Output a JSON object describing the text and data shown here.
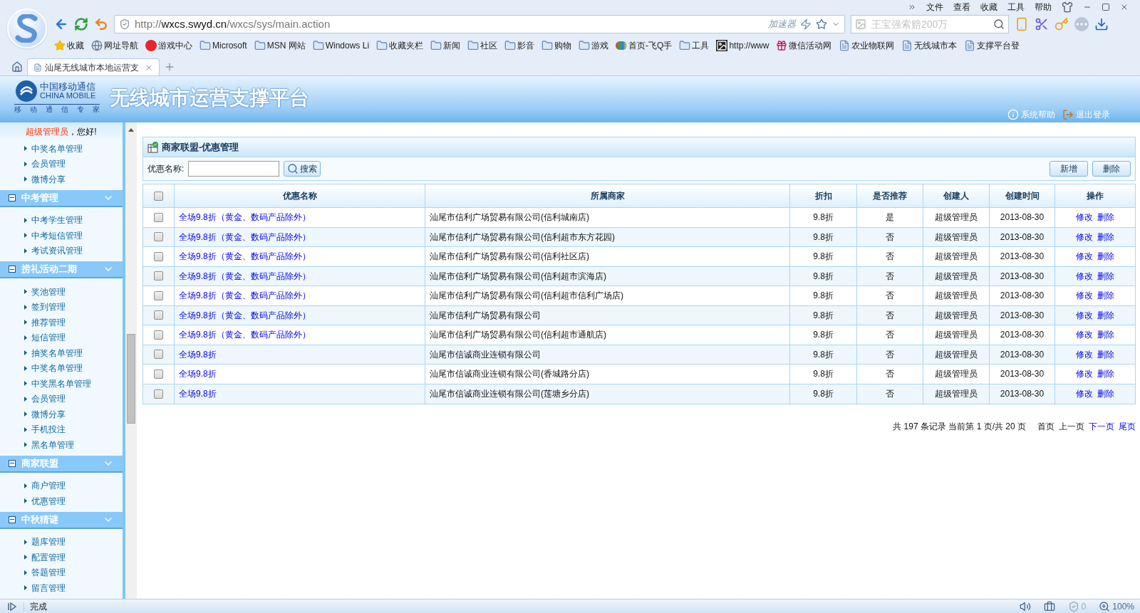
{
  "browser": {
    "menu": [
      "文件",
      "查看",
      "收藏",
      "工具",
      "帮助"
    ],
    "url_prefix": "http://",
    "url_host": "wxcs.swyd.cn",
    "url_path": "/wxcs/sys/main.action",
    "accelerator": "加速器",
    "search": {
      "placeholder": "王宝强索赔200万"
    },
    "bookmarks": [
      {
        "kind": "star",
        "label": "收藏"
      },
      {
        "kind": "globe",
        "label": "网址导航"
      },
      {
        "kind": "game",
        "label": "游戏中心"
      },
      {
        "kind": "folder",
        "label": "Microsoft"
      },
      {
        "kind": "folder",
        "label": "MSN 网站"
      },
      {
        "kind": "folder",
        "label": "Windows Li"
      },
      {
        "kind": "folder",
        "label": "收藏夹栏"
      },
      {
        "kind": "folder",
        "label": "新闻"
      },
      {
        "kind": "folder",
        "label": "社区"
      },
      {
        "kind": "folder",
        "label": "影音"
      },
      {
        "kind": "folder",
        "label": "购物"
      },
      {
        "kind": "folder",
        "label": "游戏"
      },
      {
        "kind": "app",
        "label": "首页-飞Q手"
      },
      {
        "kind": "folder",
        "label": "工具"
      },
      {
        "kind": "photo",
        "label": "http://www"
      },
      {
        "kind": "gift",
        "label": "微信活动网"
      },
      {
        "kind": "page",
        "label": "农业物联网"
      },
      {
        "kind": "page",
        "label": "无线城市本"
      },
      {
        "kind": "page",
        "label": "支撑平台登"
      }
    ],
    "tabs": [
      {
        "label": "汕尾无线城市本地运营支",
        "selected": true
      }
    ]
  },
  "banner": {
    "logo_cn": "中国移动通信",
    "logo_en": "CHINA MOBILE",
    "logo_motto": [
      "移",
      "动",
      "通",
      "信",
      "专",
      "家"
    ],
    "title": "无线城市运营支撑平台",
    "links": [
      {
        "kind": "help",
        "label": "系统帮助"
      },
      {
        "kind": "logout",
        "label": "退出登录"
      }
    ]
  },
  "sidebar": {
    "greeting_name": "超级管理员",
    "greeting_suffix": "，您好!",
    "groups": [
      {
        "items": [
          "中奖名单管理",
          "会员管理",
          "微博分享"
        ]
      },
      {
        "title": "中考管理",
        "expanded": true,
        "items": [
          "中考学生管理",
          "中考短信管理",
          "考试资讯管理"
        ]
      },
      {
        "title": "捞礼活动二期",
        "expanded": true,
        "items": [
          "奖池管理",
          "签到管理",
          "推荐管理",
          "短信管理",
          "抽奖名单管理",
          "中奖名单管理",
          "中奖黑名单管理",
          "会员管理",
          "微博分享",
          "手机投注",
          "黑名单管理"
        ]
      },
      {
        "title": "商家联盟",
        "expanded": true,
        "items": [
          "商户管理",
          "优惠管理"
        ]
      },
      {
        "title": "中秋猜谜",
        "expanded": true,
        "items": [
          "题库管理",
          "配置管理",
          "答题管理",
          "留言管理"
        ]
      }
    ]
  },
  "panel": {
    "title": "商家联盟-优惠管理",
    "search_label": "优惠名称:",
    "search_button": "搜索",
    "actions": [
      "新增",
      "删除"
    ]
  },
  "table": {
    "header_checked": false,
    "columns": [
      "优惠名称",
      "所属商家",
      "折扣",
      "是否推荐",
      "创建人",
      "创建时间",
      "操作"
    ],
    "rows": [
      {
        "checked": false,
        "name": "全场9.8折（黄金、数码产品除外）",
        "merchant": "汕尾市信利广场贸易有限公司(信利城南店)",
        "discount": "9.8折",
        "recommended": "是",
        "creator": "超级管理员",
        "created": "2013-08-30",
        "ops": [
          "修改",
          "删除"
        ]
      },
      {
        "checked": false,
        "name": "全场9.8折（黄金、数码产品除外）",
        "merchant": "汕尾市信利广场贸易有限公司(信利超市东方花园)",
        "discount": "9.8折",
        "recommended": "否",
        "creator": "超级管理员",
        "created": "2013-08-30",
        "ops": [
          "修改",
          "删除"
        ]
      },
      {
        "checked": false,
        "name": "全场9.8折（黄金、数码产品除外）",
        "merchant": "汕尾市信利广场贸易有限公司(信利社区店)",
        "discount": "9.8折",
        "recommended": "否",
        "creator": "超级管理员",
        "created": "2013-08-30",
        "ops": [
          "修改",
          "删除"
        ]
      },
      {
        "checked": false,
        "name": "全场9.8折（黄金、数码产品除外）",
        "merchant": "汕尾市信利广场贸易有限公司(信利超市滨海店)",
        "discount": "9.8折",
        "recommended": "否",
        "creator": "超级管理员",
        "created": "2013-08-30",
        "ops": [
          "修改",
          "删除"
        ]
      },
      {
        "checked": false,
        "name": "全场9.8折（黄金、数码产品除外）",
        "merchant": "汕尾市信利广场贸易有限公司(信利超市信利广场店)",
        "discount": "9.8折",
        "recommended": "否",
        "creator": "超级管理员",
        "created": "2013-08-30",
        "ops": [
          "修改",
          "删除"
        ]
      },
      {
        "checked": false,
        "name": "全场9.8折（黄金、数码产品除外）",
        "merchant": "汕尾市信利广场贸易有限公司",
        "discount": "9.8折",
        "recommended": "否",
        "creator": "超级管理员",
        "created": "2013-08-30",
        "ops": [
          "修改",
          "删除"
        ]
      },
      {
        "checked": false,
        "name": "全场9.8折（黄金、数码产品除外）",
        "merchant": "汕尾市信利广场贸易有限公司(信利超市通航店)",
        "discount": "9.8折",
        "recommended": "否",
        "creator": "超级管理员",
        "created": "2013-08-30",
        "ops": [
          "修改",
          "删除"
        ]
      },
      {
        "checked": false,
        "name": "全场9.8折",
        "merchant": "汕尾市信诚商业连锁有限公司",
        "discount": "9.8折",
        "recommended": "否",
        "creator": "超级管理员",
        "created": "2013-08-30",
        "ops": [
          "修改",
          "删除"
        ]
      },
      {
        "checked": false,
        "name": "全场9.8折",
        "merchant": "汕尾市信诚商业连锁有限公司(香城路分店)",
        "discount": "9.8折",
        "recommended": "否",
        "creator": "超级管理员",
        "created": "2013-08-30",
        "ops": [
          "修改",
          "删除"
        ]
      },
      {
        "checked": false,
        "name": "全场9.8折",
        "merchant": "汕尾市信诚商业连锁有限公司(莲塘乡分店)",
        "discount": "9.8折",
        "recommended": "否",
        "creator": "超级管理员",
        "created": "2013-08-30",
        "ops": [
          "修改",
          "删除"
        ]
      }
    ]
  },
  "pagination": {
    "summary": "共 197 条记录 当前第 1 页/共 20 页",
    "links": [
      {
        "label": "首页",
        "disabled": true
      },
      {
        "label": "上一页",
        "disabled": true
      },
      {
        "label": "下一页",
        "disabled": false
      },
      {
        "label": "尾页",
        "disabled": false
      }
    ]
  },
  "status_bar": {
    "text": "完成",
    "ad_count": "0",
    "zoom": "100%"
  }
}
